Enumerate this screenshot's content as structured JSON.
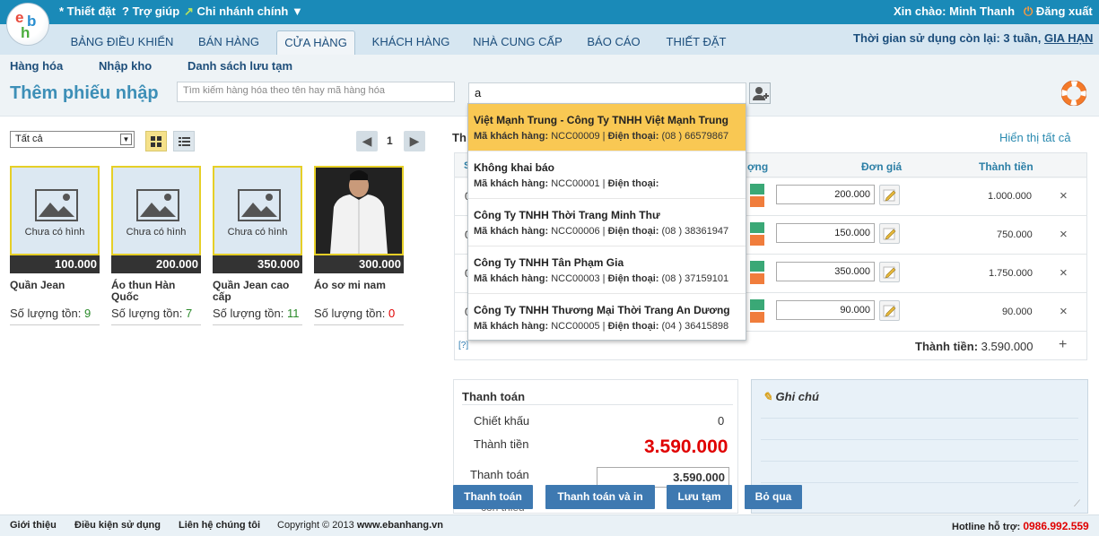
{
  "header": {
    "settings": "Thiết đặt",
    "help": "Trợ giúp",
    "branch": "Chi nhánh chính",
    "greeting": "Xin chào: Minh Thanh",
    "logout": "Đăng xuất"
  },
  "nav": {
    "tabs": [
      "BẢNG ĐIỀU KHIỂN",
      "BÁN HÀNG",
      "CỬA HÀNG",
      "KHÁCH HÀNG",
      "NHÀ CUNG CẤP",
      "BÁO CÁO",
      "THIẾT ĐẶT"
    ],
    "active": "CỬA HÀNG",
    "usage": "Thời gian sử dụng còn lại: 3 tuần,",
    "renew": "GIA HẠN"
  },
  "subnav": [
    "Hàng hóa",
    "Nhập kho",
    "Danh sách lưu tạm"
  ],
  "page": {
    "title": "Thêm phiếu nhập",
    "search_placeholder": "Tìm kiếm hàng hóa theo tên hay mã hàng hóa",
    "supplier_value": "a"
  },
  "filter": {
    "selected": "Tất cả",
    "page": "1"
  },
  "products": [
    {
      "name": "Quần Jean",
      "price": "100.000",
      "stock_label": "Số lượng tồn:",
      "stock": "9",
      "image": "Chưa có hình"
    },
    {
      "name": "Áo thun Hàn Quốc",
      "price": "200.000",
      "stock_label": "Số lượng tồn:",
      "stock": "7",
      "image": "Chưa có hình"
    },
    {
      "name": "Quần Jean cao cấp",
      "price": "350.000",
      "stock_label": "Số lượng tồn:",
      "stock": "11",
      "image": "Chưa có hình"
    },
    {
      "name": "Áo sơ mi nam",
      "price": "300.000",
      "stock_label": "Số lượng tồn:",
      "stock": "0",
      "image": ""
    }
  ],
  "grid": {
    "label_partial": "Th",
    "show_all": "Hiển thị tất cả",
    "col_s": "S",
    "col_qty": "ợng",
    "col_price": "Đơn giá",
    "col_total": "Thành tiền",
    "rows": [
      {
        "code": "0",
        "price": "200.000",
        "total": "1.000.000"
      },
      {
        "code": "0",
        "price": "150.000",
        "total": "750.000"
      },
      {
        "code": "0",
        "price": "350.000",
        "total": "1.750.000"
      },
      {
        "code": "0",
        "price": "90.000",
        "total": "90.000"
      }
    ],
    "help": "[?]",
    "sum_label": "Thành tiền:",
    "sum_value": "3.590.000",
    "remove_glyph": "×",
    "add_glyph": "+"
  },
  "dropdown": [
    {
      "name": "Việt Mạnh Trung - Công Ty TNHH Việt Mạnh Trung",
      "code_label": "Mã khách hàng:",
      "code": "NCC00009",
      "phone_label": "Điện thoại:",
      "phone": "(08 ) 66579867",
      "highlight": true
    },
    {
      "name": "Không khai báo",
      "code_label": "Mã khách hàng:",
      "code": "NCC00001",
      "phone_label": "Điện thoại:",
      "phone": "",
      "highlight": false
    },
    {
      "name": "Công Ty TNHH Thời Trang Minh Thư",
      "code_label": "Mã khách hàng:",
      "code": "NCC00006",
      "phone_label": "Điện thoại:",
      "phone": "(08 ) 38361947",
      "highlight": false
    },
    {
      "name": "Công Ty TNHH Tân Phạm Gia",
      "code_label": "Mã khách hàng:",
      "code": "NCC00003",
      "phone_label": "Điện thoại:",
      "phone": "(08 ) 37159101",
      "highlight": false
    },
    {
      "name": "Công Ty TNHH Thương Mại Thời Trang An Dương",
      "code_label": "Mã khách hàng:",
      "code": "NCC00005",
      "phone_label": "Điện thoại:",
      "phone": "(04 ) 36415898",
      "highlight": false
    }
  ],
  "payment": {
    "title": "Thanh toán",
    "discount_label": "Chiết khấu",
    "discount": "0",
    "total_label": "Thành tiền",
    "total": "3.590.000",
    "pay_label": "Thanh toán",
    "pay": "3.590.000",
    "partial_text": "còn thiếu"
  },
  "notes": {
    "title": "Ghi chú"
  },
  "buttons": {
    "pay": "Thanh toán",
    "pay_print": "Thanh toán và in",
    "save_draft": "Lưu tạm",
    "skip": "Bỏ qua"
  },
  "footer": {
    "intro": "Giới thiệu",
    "terms": "Điều kiện sử dụng",
    "contact": "Liên hệ chúng tôi",
    "copyright": "Copyright © 2013",
    "site": "www.ebanhang.vn",
    "hotline_label": "Hotline hỗ trợ:",
    "hotline": "0986.992.559"
  },
  "colors": {
    "accent": "#1a8ab8",
    "price_red": "#e00000",
    "highlight": "#f9c853",
    "stock_green": "#2a8a2a"
  }
}
